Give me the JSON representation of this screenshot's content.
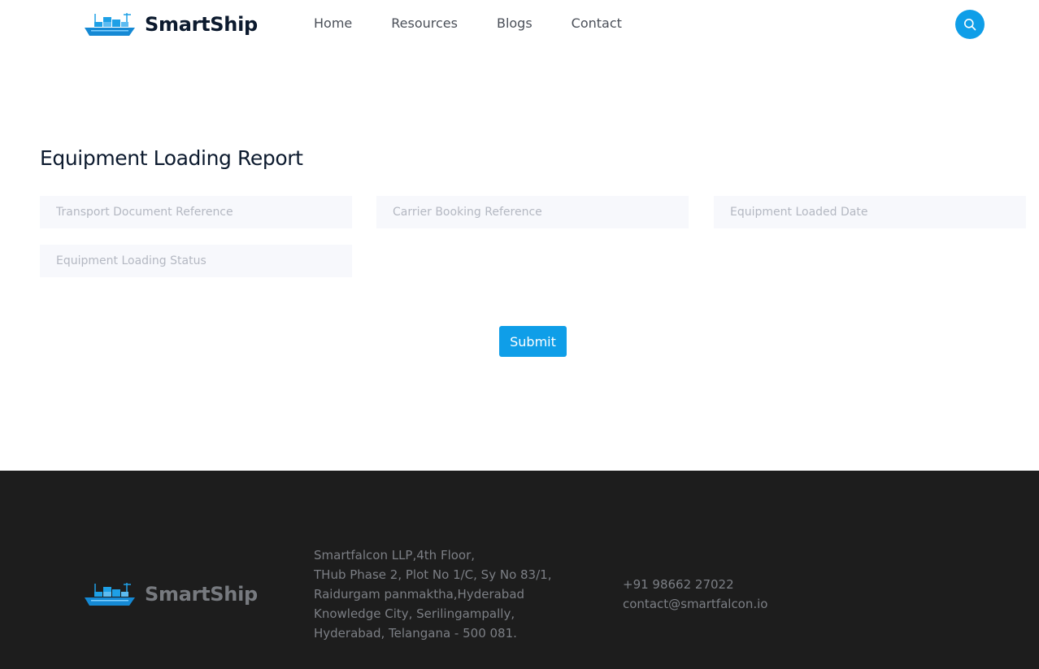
{
  "header": {
    "brand": "SmartShip",
    "nav": [
      "Home",
      "Resources",
      "Blogs",
      "Contact"
    ],
    "search_icon": "search-icon"
  },
  "colors": {
    "accent": "#0f9ee8",
    "heading": "#0c1a2e",
    "footer_bg": "#1d1d1d",
    "field_bg": "#f7f8fc"
  },
  "main": {
    "title": "Equipment Loading Report",
    "fields": [
      {
        "placeholder": "Transport Document Reference",
        "value": ""
      },
      {
        "placeholder": "Carrier Booking Reference",
        "value": ""
      },
      {
        "placeholder": "Equipment Loaded Date",
        "value": ""
      },
      {
        "placeholder": "Equipment Loading Status",
        "value": ""
      }
    ],
    "submit_label": "Submit"
  },
  "footer": {
    "brand": "SmartShip",
    "address_lines": [
      "Smartfalcon LLP,4th Floor,",
      "THub Phase 2, Plot No 1/C, Sy No 83/1,",
      "Raidurgam panmaktha,Hyderabad",
      "Knowledge City, Serilingampally,",
      "Hyderabad, Telangana - 500 081."
    ],
    "phone": "+91 98662 27022",
    "email": "contact@smartfalcon.io"
  }
}
